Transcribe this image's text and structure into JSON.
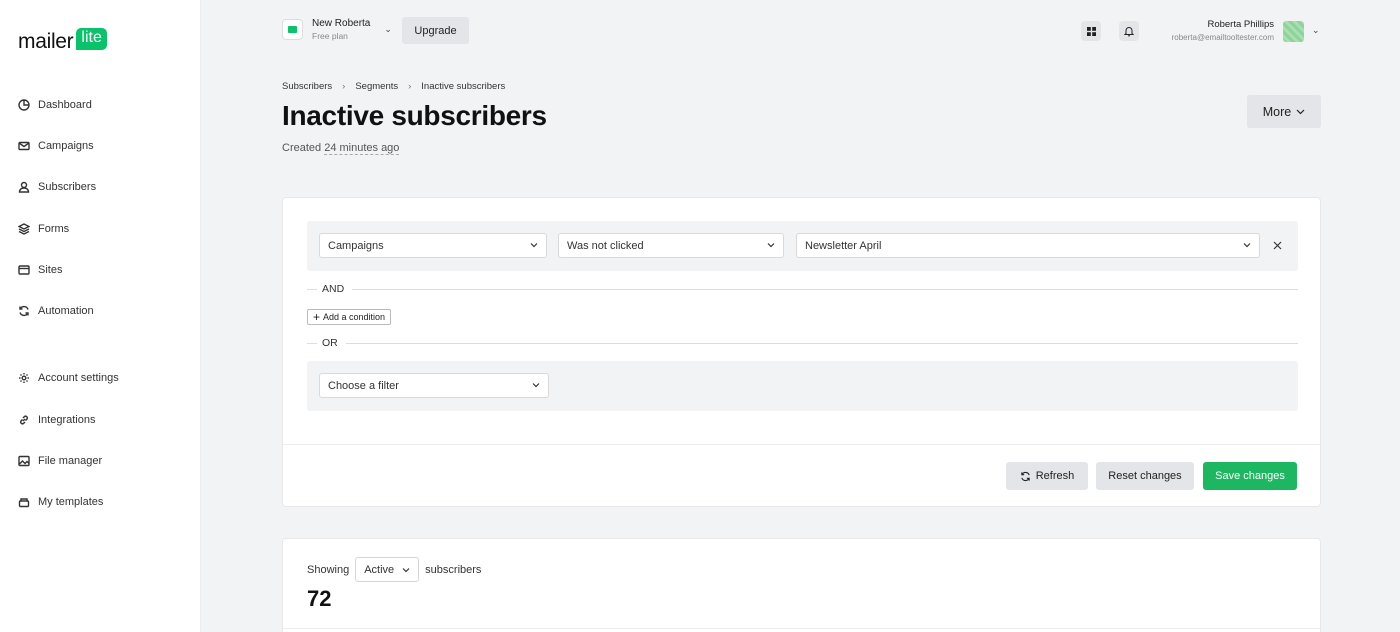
{
  "brand": {
    "logo_text": "mailer",
    "logo_badge": "lite",
    "accent": "#09c269"
  },
  "sidebar": {
    "items": [
      {
        "label": "Dashboard",
        "icon": "pie-chart-icon"
      },
      {
        "label": "Campaigns",
        "icon": "mail-icon"
      },
      {
        "label": "Subscribers",
        "icon": "user-icon"
      },
      {
        "label": "Forms",
        "icon": "layers-icon"
      },
      {
        "label": "Sites",
        "icon": "browser-icon"
      },
      {
        "label": "Automation",
        "icon": "refresh-icon"
      }
    ],
    "secondary": [
      {
        "label": "Account settings",
        "icon": "gear-icon"
      },
      {
        "label": "Integrations",
        "icon": "link-icon"
      },
      {
        "label": "File manager",
        "icon": "image-icon"
      },
      {
        "label": "My templates",
        "icon": "template-icon"
      }
    ]
  },
  "topbar": {
    "account_name": "New Roberta",
    "account_plan": "Free plan",
    "upgrade_label": "Upgrade",
    "user_name": "Roberta Phillips",
    "user_email": "roberta@emailtooltester.com"
  },
  "header": {
    "breadcrumb": [
      "Subscribers",
      "Segments",
      "Inactive subscribers"
    ],
    "title": "Inactive subscribers",
    "created_prefix": "Created",
    "created_time": "24 minutes ago",
    "more_label": "More"
  },
  "filter": {
    "rule": {
      "field": "Campaigns",
      "operator": "Was not clicked",
      "value": "Newsletter April"
    },
    "and_label": "AND",
    "add_condition_label": "Add a condition",
    "or_label": "OR",
    "choose_filter_placeholder": "Choose a filter",
    "refresh_label": "Refresh",
    "reset_label": "Reset changes",
    "save_label": "Save changes"
  },
  "subscribers": {
    "showing_label": "Showing",
    "status": "Active",
    "suffix_label": "subscribers",
    "count": "72"
  }
}
